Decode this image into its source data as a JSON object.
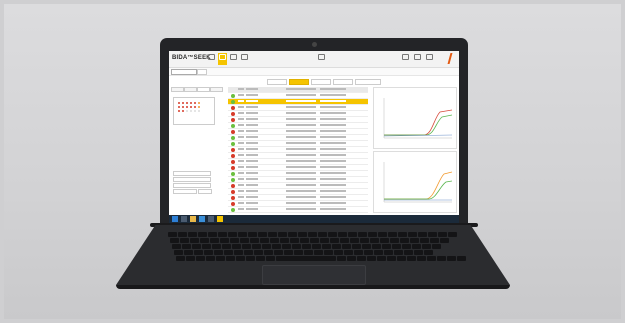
{
  "app": {
    "brand": "BIDA™SEEK"
  },
  "header": {
    "logo": "biosynex"
  },
  "colors": {
    "accent": "#f5c400",
    "positive": "#6abf3f",
    "negative": "#d63b2a",
    "chart_green": "#5ab650",
    "chart_orange": "#f29a2e",
    "chart_red": "#d84a3b"
  },
  "icons": {
    "toolbar": [
      "home-icon",
      "plate-icon",
      "analysis-icon",
      "report-icon"
    ],
    "taskbar": [
      "windows-icon",
      "search-icon",
      "folder-icon",
      "browser-icon",
      "mail-icon",
      "app-icon"
    ]
  }
}
